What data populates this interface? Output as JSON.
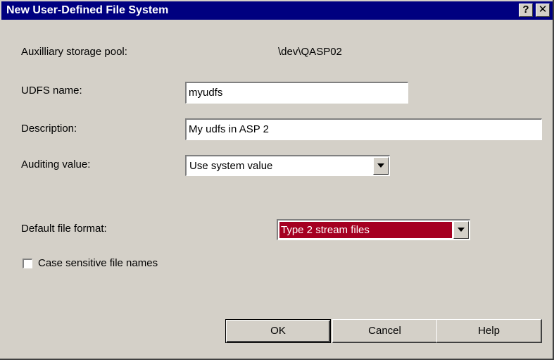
{
  "window": {
    "title": "New User-Defined File System",
    "help_glyph": "?",
    "close_glyph": "✕"
  },
  "form": {
    "asp_label": "Auxilliary storage pool:",
    "asp_value": "\\dev\\QASP02",
    "udfs_name_label": "UDFS name:",
    "udfs_name_value": "myudfs",
    "description_label": "Description:",
    "description_value": "My udfs in ASP 2",
    "auditing_label": "Auditing value:",
    "auditing_value": "Use system value",
    "default_format_label": "Default file format:",
    "default_format_value": "Type 2 stream files",
    "case_sensitive_label": "Case sensitive file names",
    "case_sensitive_checked": false
  },
  "buttons": {
    "ok": "OK",
    "cancel": "Cancel",
    "help": "Help"
  },
  "colors": {
    "titlebar": "#000080",
    "dialog_bg": "#d4d0c8",
    "selection": "#a50021"
  },
  "icons": {
    "dropdown": "chevron-down-icon",
    "help": "question-icon",
    "close": "close-icon"
  }
}
